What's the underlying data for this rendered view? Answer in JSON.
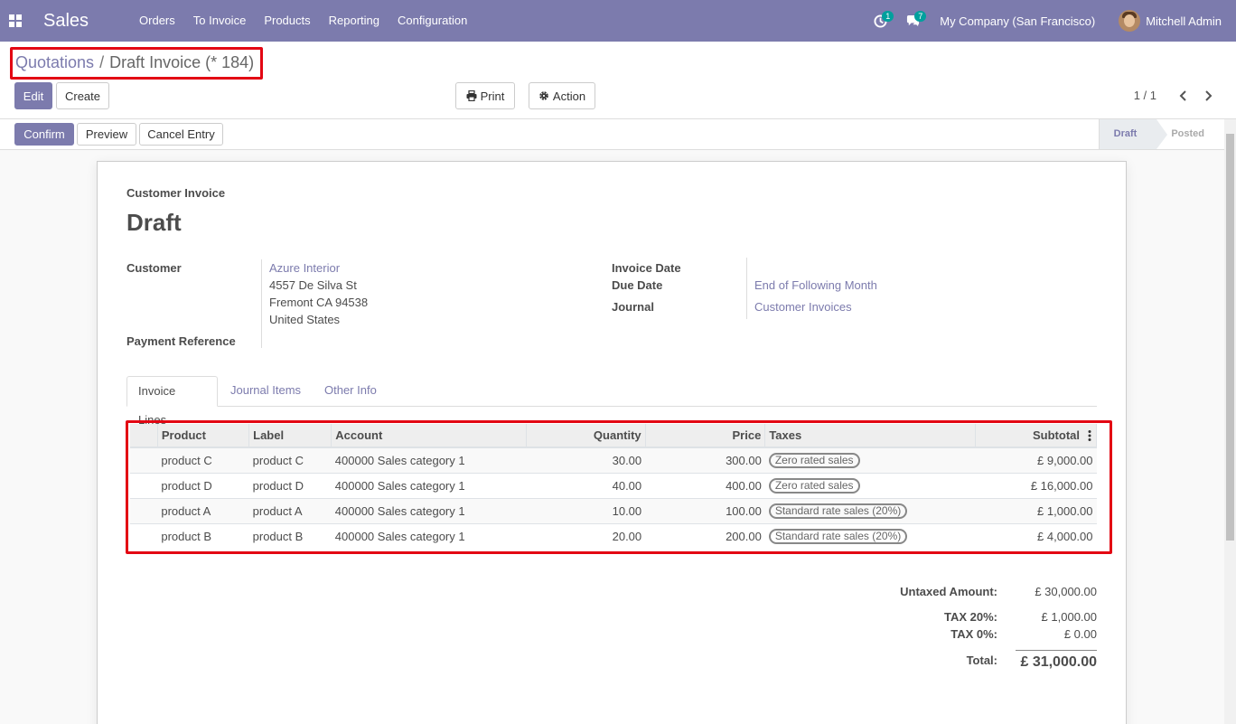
{
  "navbar": {
    "app_name": "Sales",
    "menu": [
      "Orders",
      "To Invoice",
      "Products",
      "Reporting",
      "Configuration"
    ],
    "activity_count": "1",
    "message_count": "7",
    "company": "My Company (San Francisco)",
    "user": "Mitchell Admin",
    "color": "#7c7bad"
  },
  "breadcrumb": {
    "parent": "Quotations",
    "separator": "/",
    "current": "Draft Invoice (* 184)"
  },
  "buttons": {
    "edit": "Edit",
    "create": "Create",
    "print": "Print",
    "action": "Action",
    "confirm": "Confirm",
    "preview": "Preview",
    "cancel_entry": "Cancel Entry"
  },
  "pager": {
    "value": "1 / 1"
  },
  "status": {
    "steps": [
      "Draft",
      "Posted"
    ],
    "active": "Draft"
  },
  "invoice": {
    "type": "Customer Invoice",
    "state": "Draft",
    "customer_label": "Customer",
    "customer_name": "Azure Interior",
    "address_line1": "4557 De Silva St",
    "address_line2": "Fremont CA 94538",
    "address_line3": "United States",
    "payment_reference_label": "Payment Reference",
    "invoice_date_label": "Invoice Date",
    "due_date_label": "Due Date",
    "due_date_value": "End of Following Month",
    "journal_label": "Journal",
    "journal_value": "Customer Invoices"
  },
  "tabs": [
    "Invoice Lines",
    "Journal Items",
    "Other Info"
  ],
  "lines": {
    "headers": [
      "Product",
      "Label",
      "Account",
      "Quantity",
      "Price",
      "Taxes",
      "Subtotal"
    ],
    "rows": [
      {
        "product": "product C",
        "label": "product C",
        "account": "400000 Sales category 1",
        "quantity": "30.00",
        "price": "300.00",
        "tax": "Zero rated sales",
        "subtotal": "£ 9,000.00"
      },
      {
        "product": "product D",
        "label": "product D",
        "account": "400000 Sales category 1",
        "quantity": "40.00",
        "price": "400.00",
        "tax": "Zero rated sales",
        "subtotal": "£ 16,000.00"
      },
      {
        "product": "product A",
        "label": "product A",
        "account": "400000 Sales category 1",
        "quantity": "10.00",
        "price": "100.00",
        "tax": "Standard rate sales (20%)",
        "subtotal": "£ 1,000.00"
      },
      {
        "product": "product B",
        "label": "product B",
        "account": "400000 Sales category 1",
        "quantity": "20.00",
        "price": "200.00",
        "tax": "Standard rate sales (20%)",
        "subtotal": "£ 4,000.00"
      }
    ]
  },
  "totals": {
    "untaxed_label": "Untaxed Amount:",
    "untaxed_value": "£ 30,000.00",
    "tax20_label": "TAX 20%:",
    "tax20_value": "£ 1,000.00",
    "tax0_label": "TAX 0%:",
    "tax0_value": "£ 0.00",
    "total_label": "Total:",
    "total_value": "£ 31,000.00"
  },
  "highlight_color": "#e30613"
}
